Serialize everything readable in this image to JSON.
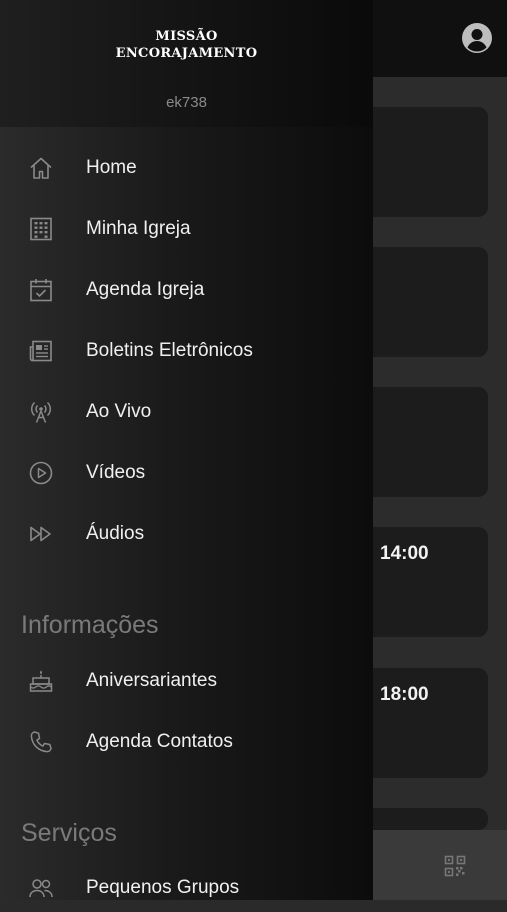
{
  "app": {
    "logo_line1": "MISSÃO",
    "logo_line2": "ENCORAJAMENTO",
    "username": "ek738"
  },
  "menu": {
    "items": [
      {
        "label": "Home",
        "icon": "home-icon"
      },
      {
        "label": "Minha Igreja",
        "icon": "building-icon"
      },
      {
        "label": "Agenda Igreja",
        "icon": "calendar-check-icon"
      },
      {
        "label": "Boletins Eletrônicos",
        "icon": "newspaper-icon"
      },
      {
        "label": "Ao Vivo",
        "icon": "broadcast-icon"
      },
      {
        "label": "Vídeos",
        "icon": "play-circle-icon"
      },
      {
        "label": "Áudios",
        "icon": "fast-forward-icon"
      }
    ],
    "sections": [
      {
        "title": "Informações",
        "items": [
          {
            "label": "Aniversariantes",
            "icon": "cake-icon"
          },
          {
            "label": "Agenda Contatos",
            "icon": "phone-icon"
          }
        ]
      },
      {
        "title": "Serviços",
        "items": [
          {
            "label": "Pequenos Grupos",
            "icon": "group-icon"
          }
        ]
      }
    ]
  },
  "background": {
    "cards": [
      {
        "time": ""
      },
      {
        "time": ""
      },
      {
        "time": ""
      },
      {
        "time": "14:00"
      },
      {
        "time": "18:00"
      }
    ]
  },
  "colors": {
    "drawer_bg": "#1a1a1a",
    "text_primary": "#f0f0f0",
    "text_secondary": "#7a7a7a"
  }
}
